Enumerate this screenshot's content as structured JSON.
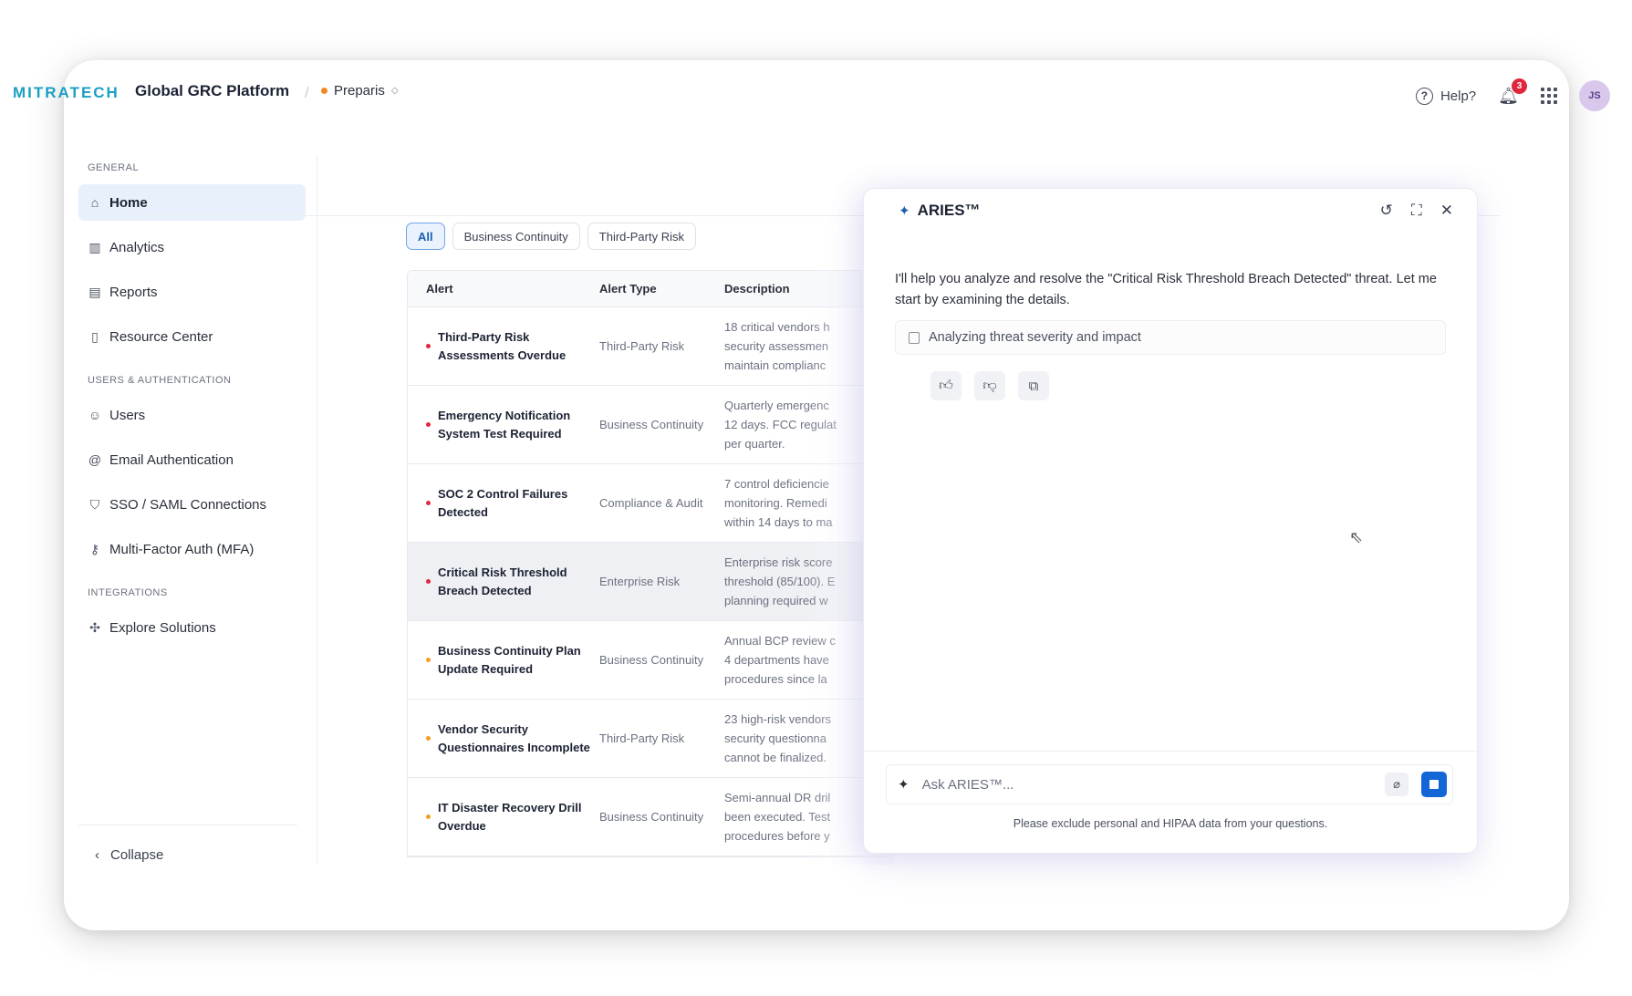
{
  "header": {
    "logo": "MITRATECH",
    "title": "Global GRC Platform",
    "separator": "/",
    "tenant": "Preparis",
    "help": "Help?",
    "notifications_count": "3",
    "avatar_initials": "JS"
  },
  "sidebar": {
    "general_label": "GENERAL",
    "general": [
      {
        "label": "Home",
        "icon": "home-icon",
        "glyph": "⌂"
      },
      {
        "label": "Analytics",
        "icon": "bar-chart-icon",
        "glyph": "▥"
      },
      {
        "label": "Reports",
        "icon": "document-icon",
        "glyph": "▤"
      },
      {
        "label": "Resource Center",
        "icon": "book-icon",
        "glyph": "▯"
      }
    ],
    "users_label": "USERS & AUTHENTICATION",
    "users": [
      {
        "label": "Users",
        "icon": "user-icon",
        "glyph": "☺"
      },
      {
        "label": "Email Authentication",
        "icon": "at-icon",
        "glyph": "@"
      },
      {
        "label": "SSO / SAML Connections",
        "icon": "shield-icon",
        "glyph": "⛉"
      },
      {
        "label": "Multi-Factor Auth (MFA)",
        "icon": "key-icon",
        "glyph": "⚷"
      }
    ],
    "integrations_label": "INTEGRATIONS",
    "integrations": [
      {
        "label": "Explore Solutions",
        "icon": "network-icon",
        "glyph": "✣"
      }
    ],
    "collapse": "Collapse"
  },
  "filters": [
    "All",
    "Business Continuity",
    "Third-Party Risk"
  ],
  "table": {
    "headers": [
      "Alert",
      "Alert Type",
      "Description"
    ],
    "rows": [
      {
        "alert": "Third-Party Risk Assessments Overdue",
        "type": "Third-Party Risk",
        "desc": [
          "18 critical vendors h",
          "security assessmen",
          "maintain complianc"
        ],
        "severity": "#e0273c"
      },
      {
        "alert": "Emergency Notification System Test Required",
        "type": "Business Continuity",
        "desc": [
          "Quarterly emergenc",
          "12 days. FCC regulat",
          "per quarter."
        ],
        "severity": "#e0273c"
      },
      {
        "alert": "SOC 2 Control Failures Detected",
        "type": "Compliance & Audit",
        "desc": [
          "7 control deficiencie",
          "monitoring. Remedi",
          "within 14 days to ma"
        ],
        "severity": "#e0273c"
      },
      {
        "alert": "Critical Risk Threshold Breach Detected",
        "type": "Enterprise Risk",
        "desc": [
          "Enterprise risk score",
          "threshold (85/100). E",
          "planning required w"
        ],
        "severity": "#e0273c"
      },
      {
        "alert": "Business Continuity Plan Update Required",
        "type": "Business Continuity",
        "desc": [
          "Annual BCP review c",
          "4 departments have",
          "procedures since la"
        ],
        "severity": "#f0a020"
      },
      {
        "alert": "Vendor Security Questionnaires Incomplete",
        "type": "Third-Party Risk",
        "desc": [
          "23 high-risk vendors",
          "security questionna",
          "cannot be finalized."
        ],
        "severity": "#f0a020"
      },
      {
        "alert": "IT Disaster Recovery Drill Overdue",
        "type": "Business Continuity",
        "desc": [
          "Semi-annual DR dril",
          "been executed. Test",
          "procedures before y"
        ],
        "severity": "#f0a020"
      }
    ]
  },
  "aries": {
    "title": "ARIES™",
    "message": "I'll help you analyze and resolve the \"Critical Risk Threshold Breach Detected\" threat. Let me start by examining the details.",
    "status": "Analyzing threat severity and impact",
    "input_placeholder": "Ask ARIES™...",
    "disclaimer": "Please exclude personal and HIPAA data from your questions."
  }
}
